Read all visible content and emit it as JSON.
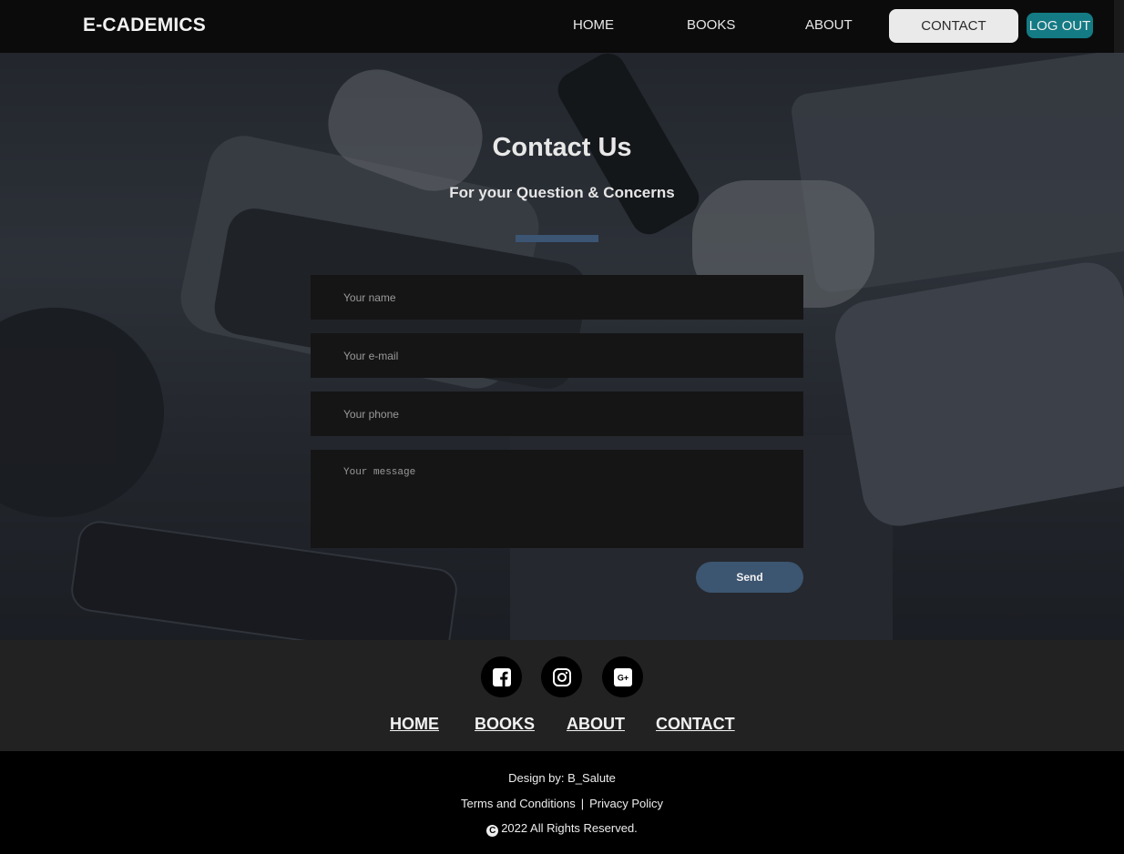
{
  "navbar": {
    "logo": "E-CADEMICS",
    "links": {
      "home": "HOME",
      "books": "BOOKS",
      "about": "ABOUT",
      "contact": "CONTACT"
    },
    "logout": "LOG OUT",
    "active_color": "#eaeaea",
    "logout_color": "#147a84"
  },
  "hero": {
    "title": "Contact Us",
    "subtitle": "For your Question & Concerns",
    "accent_color": "#3b5573"
  },
  "form": {
    "name_placeholder": "Your name",
    "email_placeholder": "Your e-mail",
    "phone_placeholder": "Your phone",
    "message_placeholder": "Your message",
    "send_label": "Send"
  },
  "footer": {
    "social_icons": [
      "facebook-icon",
      "instagram-icon",
      "google-plus-icon"
    ],
    "links": {
      "home": "HOME",
      "books": "BOOKS",
      "about": "ABOUT",
      "contact": "CONTACT"
    },
    "credit": "Design by: B_Salute",
    "terms": "Terms and Conditions",
    "separator": "|",
    "privacy": "Privacy Policy",
    "copyright": "2022 All Rights Reserved."
  }
}
